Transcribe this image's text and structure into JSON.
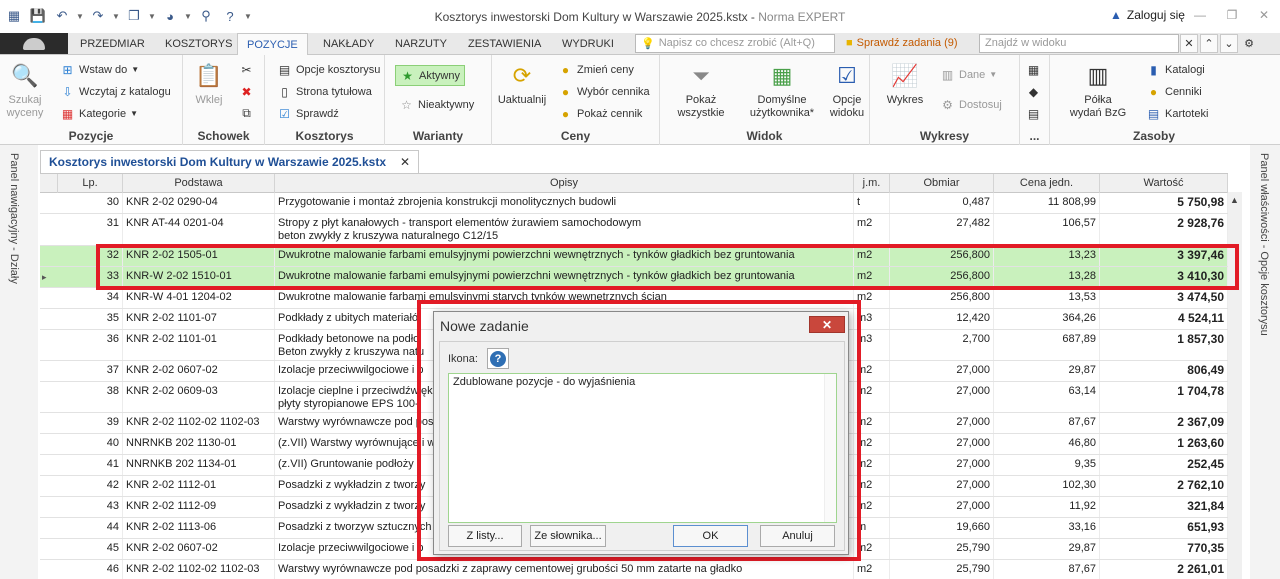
{
  "window": {
    "title": "Kosztorys inwestorski Dom Kultury w Warszawie 2025.kstx",
    "app": "Norma EXPERT",
    "login": "Zaloguj się"
  },
  "ribbon_tabs": [
    "PRZEDMIAR",
    "KOSZTORYS",
    "POZYCJE",
    "NAKŁADY",
    "NARZUTY",
    "ZESTAWIENIA",
    "WYDRUKI"
  ],
  "tellme_placeholder": "Napisz co chcesz zrobić (Alt+Q)",
  "check_tasks": "Sprawdź zadania (9)",
  "find_placeholder": "Znajdź w widoku",
  "ribbon": {
    "szukaj": [
      "Szukaj",
      "wyceny"
    ],
    "wstaw": "Wstaw do",
    "wczytaj": "Wczytaj z katalogu",
    "kategorie": "Kategorie",
    "pozycje_label": "Pozycje",
    "wklej": "Wklej",
    "schowek_label": "Schowek",
    "opcje_kosztorysu": "Opcje kosztorysu",
    "strona_tytulowa": "Strona tytułowa",
    "sprawdz": "Sprawdź",
    "kosztorys_label": "Kosztorys",
    "aktywny": "Aktywny",
    "nieaktywny": "Nieaktywny",
    "warianty_label": "Warianty",
    "uaktualnij": "Uaktualnij",
    "zmien_ceny": "Zmień ceny",
    "wybor_cennika": "Wybór cennika",
    "pokaz_cennik": "Pokaż cennik",
    "ceny_label": "Ceny",
    "pokaz_wszystkie": [
      "Pokaż",
      "wszystkie"
    ],
    "domyslne": [
      "Domyślne",
      "użytkownika*"
    ],
    "opcje_widoku": [
      "Opcje",
      "widoku"
    ],
    "widok_label": "Widok",
    "wykres": "Wykres",
    "dane": "Dane",
    "dostosuj": "Dostosuj",
    "wykresy_label": "Wykresy",
    "dots_label": "...",
    "polka": [
      "Półka",
      "wydań BzG"
    ],
    "katalogi": "Katalogi",
    "cenniki": "Cenniki",
    "kartoteki": "Kartoteki",
    "zasoby_label": "Zasoby"
  },
  "left_panel": "Panel nawigacyjny - Działy",
  "right_panel": "Panel właściwości - Opcje kosztorysu",
  "doc_tab": "Kosztorys inwestorski Dom Kultury w Warszawie 2025.kstx",
  "columns": [
    "Lp.",
    "Podstawa",
    "Opisy",
    "j.m.",
    "Obmiar",
    "Cena jedn.",
    "Wartość"
  ],
  "rows": [
    {
      "lp": "30",
      "podstawa": "KNR 2-02 0290-04",
      "opis": "Przygotowanie i montaż zbrojenia konstrukcji monolitycznych budowli",
      "opis2": "",
      "jm": "t",
      "obmiar": "0,487",
      "cena": "11 808,99",
      "wartosc": "5 750,98"
    },
    {
      "lp": "31",
      "podstawa": "KNR AT-44 0201-04",
      "opis": "Stropy z płyt kanałowych - transport elementów żurawiem samochodowym",
      "opis2": "beton zwykły z kruszywa naturalnego C12/15",
      "jm": "m2",
      "obmiar": "27,482",
      "cena": "106,57",
      "wartosc": "2 928,76"
    },
    {
      "lp": "32",
      "podstawa": "KNR 2-02 1505-01",
      "opis": "Dwukrotne malowanie farbami emulsyjnymi powierzchni wewnętrznych - tynków gładkich bez gruntowania",
      "opis2": "",
      "jm": "m2",
      "obmiar": "256,800",
      "cena": "13,23",
      "wartosc": "3 397,46"
    },
    {
      "lp": "33",
      "podstawa": "KNR-W 2-02 1510-01",
      "opis": "Dwukrotne malowanie farbami emulsyjnymi powierzchni wewnętrznych - tynków gładkich bez gruntowania",
      "opis2": "",
      "jm": "m2",
      "obmiar": "256,800",
      "cena": "13,28",
      "wartosc": "3 410,30"
    },
    {
      "lp": "34",
      "podstawa": "KNR-W 4-01 1204-02",
      "opis": "Dwukrotne malowanie farbami emulsyjnymi starych tynków wewnętrznych ścian",
      "opis2": "",
      "jm": "m2",
      "obmiar": "256,800",
      "cena": "13,53",
      "wartosc": "3 474,50"
    },
    {
      "lp": "35",
      "podstawa": "KNR 2-02 1101-07",
      "opis": "Podkłady z ubitych materiałó",
      "opis2": "",
      "jm": "m3",
      "obmiar": "12,420",
      "cena": "364,26",
      "wartosc": "4 524,11"
    },
    {
      "lp": "36",
      "podstawa": "KNR 2-02 1101-01",
      "opis": "Podkłady betonowe na podło",
      "opis2": "Beton zwykły z kruszywa natu",
      "jm": "m3",
      "obmiar": "2,700",
      "cena": "687,89",
      "wartosc": "1 857,30"
    },
    {
      "lp": "37",
      "podstawa": "KNR 2-02 0607-02",
      "opis": "Izolacje przeciwwilgociowe i p",
      "opis2": "",
      "jm": "m2",
      "obmiar": "27,000",
      "cena": "29,87",
      "wartosc": "806,49"
    },
    {
      "lp": "38",
      "podstawa": "KNR 2-02 0609-03",
      "opis": "Izolacje cieplne i przeciwdźwięk",
      "opis2": "płyty styropianowe EPS 100-",
      "jm": "m2",
      "obmiar": "27,000",
      "cena": "63,14",
      "wartosc": "1 704,78"
    },
    {
      "lp": "39",
      "podstawa": "KNR 2-02 1102-02 1102-03",
      "opis": "Warstwy wyrównawcze pod pos",
      "opis2": "",
      "jm": "m2",
      "obmiar": "27,000",
      "cena": "87,67",
      "wartosc": "2 367,09"
    },
    {
      "lp": "40",
      "podstawa": "NNRNKB 202 1130-01",
      "opis": "(z.VII) Warstwy wyrównujące i w",
      "opis2": "",
      "jm": "m2",
      "obmiar": "27,000",
      "cena": "46,80",
      "wartosc": "1 263,60"
    },
    {
      "lp": "41",
      "podstawa": "NNRNKB 202 1134-01",
      "opis": "(z.VII) Gruntowanie podłoży",
      "opis2": "",
      "jm": "m2",
      "obmiar": "27,000",
      "cena": "9,35",
      "wartosc": "252,45"
    },
    {
      "lp": "42",
      "podstawa": "KNR 2-02 1112-01",
      "opis": "Posadzki z wykładzin z tworzy",
      "opis2": "",
      "jm": "m2",
      "obmiar": "27,000",
      "cena": "102,30",
      "wartosc": "2 762,10"
    },
    {
      "lp": "43",
      "podstawa": "KNR 2-02 1112-09",
      "opis": "Posadzki z wykładzin z tworzy",
      "opis2": "",
      "jm": "m2",
      "obmiar": "27,000",
      "cena": "11,92",
      "wartosc": "321,84"
    },
    {
      "lp": "44",
      "podstawa": "KNR 2-02 1113-06",
      "opis": "Posadzki z tworzyw sztucznych",
      "opis2": "",
      "jm": "m",
      "obmiar": "19,660",
      "cena": "33,16",
      "wartosc": "651,93"
    },
    {
      "lp": "45",
      "podstawa": "KNR 2-02 0607-02",
      "opis": "Izolacje przeciwwilgociowe i p",
      "opis2": "",
      "jm": "m2",
      "obmiar": "25,790",
      "cena": "29,87",
      "wartosc": "770,35"
    },
    {
      "lp": "46",
      "podstawa": "KNR 2-02 1102-02 1102-03",
      "opis": "Warstwy wyrównawcze pod posadzki z zaprawy cementowej grubości 50 mm zatarte na gładko",
      "opis2": "",
      "jm": "m2",
      "obmiar": "25,790",
      "cena": "87,67",
      "wartosc": "2 261,01"
    }
  ],
  "dialog": {
    "title": "Nowe zadanie",
    "icon_label": "Ikona:",
    "icon_glyph": "?",
    "text": "Zdublowane pozycje - do wyjaśnienia",
    "btn_list": "Z listy...",
    "btn_dict": "Ze słownika...",
    "btn_ok": "OK",
    "btn_cancel": "Anuluj"
  },
  "colors": {
    "highlight": "#e21b26",
    "selected_row": "#c9f1bd",
    "accent": "#2a5db0"
  }
}
